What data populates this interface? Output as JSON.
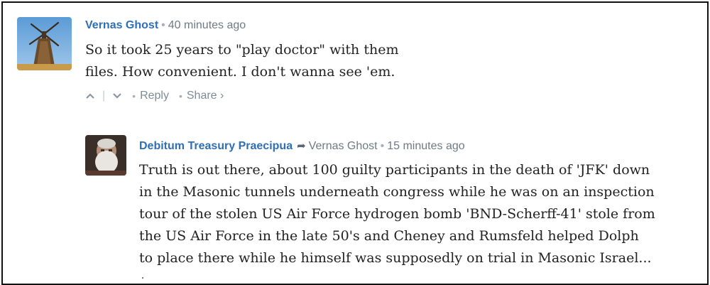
{
  "comments": [
    {
      "author": "Vernas Ghost",
      "separator": "•",
      "time": "40 minutes ago",
      "lines": [
        "So it took 25 years to \"play doctor\" with them",
        "files. How convenient. I don't wanna see 'em."
      ],
      "actions": {
        "upvote_icon": "chevron-up-icon",
        "downvote_icon": "chevron-down-icon",
        "reply_label": "Reply",
        "share_label": "Share ›"
      }
    },
    {
      "author": "Debitum Treasury Praecipua",
      "reply_to_icon": "reply-arrow-icon",
      "reply_to": "Vernas Ghost",
      "separator": "•",
      "time": "15 minutes ago",
      "lines": [
        "Truth is out there, about 100 guilty participants in the death of 'JFK' down",
        "in the Masonic tunnels underneath congress while he was on an inspection",
        "tour of the stolen US Air Force hydrogen bomb 'BND-Scherff-41' stole from",
        "the US Air Force in the late 50's and Cheney and Rumsfeld helped Dolph",
        "to place there while he himself was supposedly on trial in Masonic Israel..."
      ]
    }
  ],
  "colors": {
    "author": "#2f6fb5",
    "meta": "#7f8b95",
    "text": "#222222",
    "frame": "#111111"
  }
}
